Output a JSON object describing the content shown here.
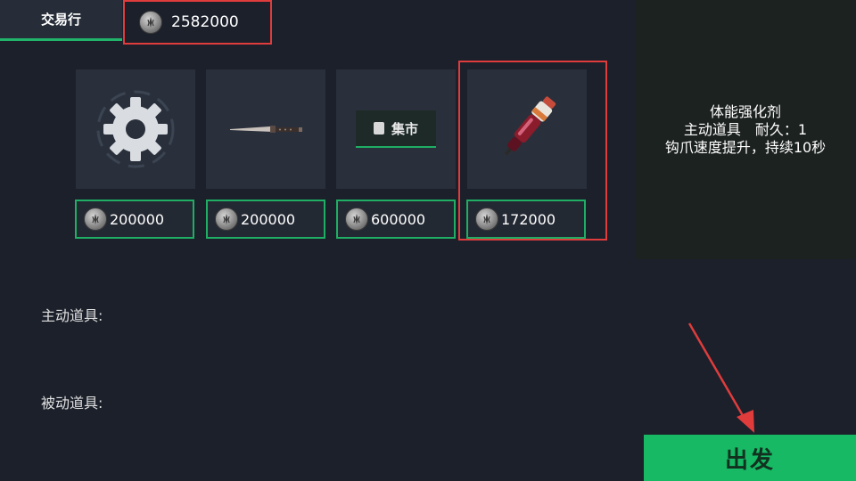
{
  "tabs": {
    "trade_label": "交易行"
  },
  "wallet": {
    "balance": "2582000",
    "icon": "coin-icon"
  },
  "items": [
    {
      "name_icon": "gear-icon",
      "price": "200000"
    },
    {
      "name_icon": "knife-icon",
      "price": "200000"
    },
    {
      "name_icon": "market-icon",
      "market_label": "集市",
      "price": "600000"
    },
    {
      "name_icon": "injector-icon",
      "price": "172000"
    }
  ],
  "info": {
    "title": "体能强化剂",
    "type_line": "主动道具　耐久：1",
    "desc": "钩爪速度提升，持续10秒"
  },
  "sections": {
    "active_label": "主动道具:",
    "passive_label": "被动道具:"
  },
  "actions": {
    "depart_label": "出发"
  },
  "colors": {
    "accent": "#17b964",
    "highlight": "#e03c3c",
    "bg": "#1b202b"
  }
}
